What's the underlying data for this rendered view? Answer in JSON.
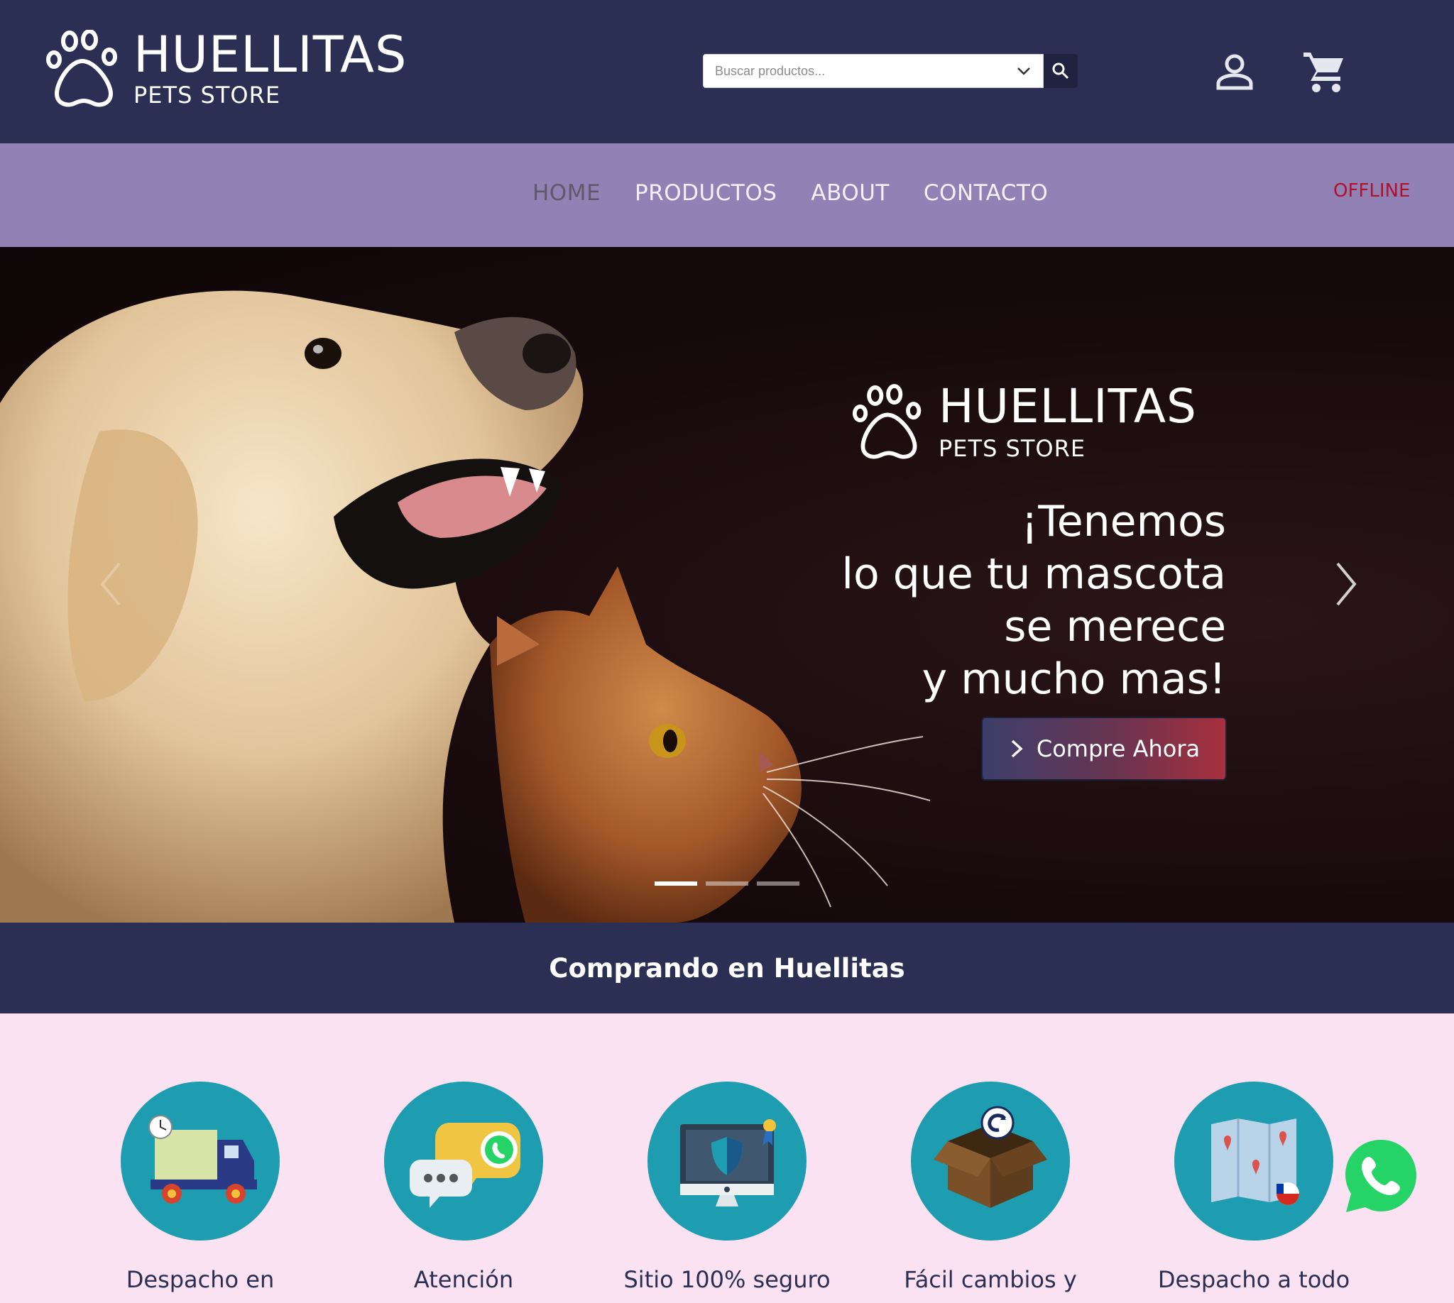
{
  "brand": {
    "title": "HUELLITAS",
    "subtitle": "PETS STORE"
  },
  "search": {
    "placeholder": "Buscar productos..."
  },
  "nav": {
    "items": [
      {
        "label": "HOME",
        "active": true
      },
      {
        "label": "PRODUCTOS",
        "active": false
      },
      {
        "label": "ABOUT",
        "active": false
      },
      {
        "label": "CONTACTO",
        "active": false
      }
    ],
    "status": "OFFLINE"
  },
  "hero": {
    "brand_title": "HUELLITAS",
    "brand_subtitle": "PETS STORE",
    "headline": [
      "¡Tenemos",
      "lo que tu mascota",
      "se merece",
      "y mucho mas!"
    ],
    "cta": "Compre Ahora",
    "slides": 3,
    "active_slide": 1
  },
  "section": {
    "title": "Comprando en Huellitas"
  },
  "features": [
    {
      "label": "Despacho en",
      "icon": "delivery-truck-icon"
    },
    {
      "label": "Atención",
      "icon": "chat-support-icon"
    },
    {
      "label": "Sitio 100% seguro",
      "icon": "secure-site-icon"
    },
    {
      "label": "Fácil cambios y",
      "icon": "return-box-icon"
    },
    {
      "label": "Despacho a todo",
      "icon": "map-delivery-icon"
    }
  ],
  "colors": {
    "header": "#2b2f53",
    "nav": "#9281b4",
    "offline": "#b0122d",
    "feature_circle": "#1e9db0",
    "background": "#fbe2f3",
    "whatsapp": "#25d366"
  }
}
